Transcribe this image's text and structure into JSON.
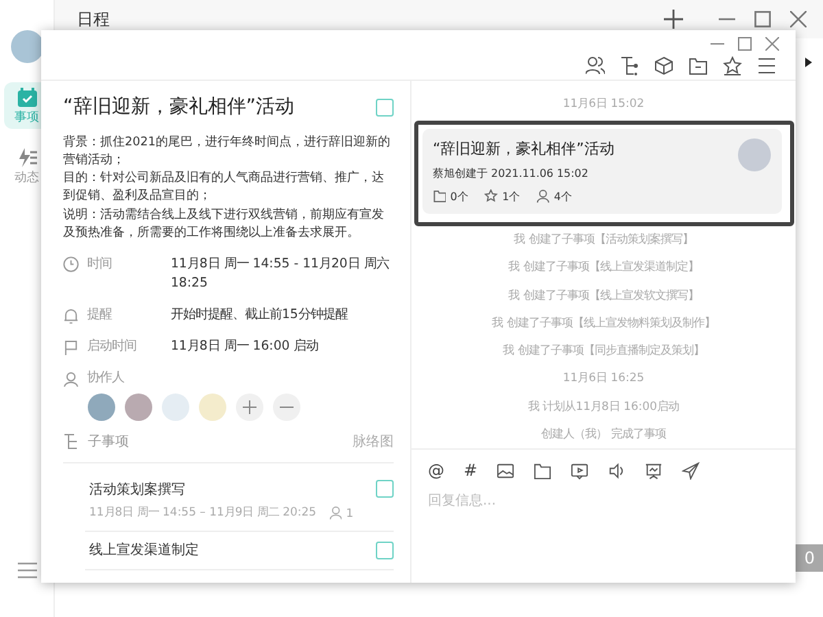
{
  "app": {
    "title": "日程",
    "nav": [
      {
        "kind": "calendar",
        "label": "事项",
        "selected": true
      },
      {
        "kind": "activity",
        "label": "动态",
        "selected": false
      }
    ],
    "badge": "0"
  },
  "task": {
    "title": "“辞旧迎新，豪礼相伴”活动",
    "checked": false,
    "description": [
      "背景：抓住2021的尾巴，进行年终时间点，进行辞旧迎新的营销活动；",
      "目的：针对公司新品及旧有的人气商品进行营销、推广，达到促销、盈利及品宣目的；",
      "说明：活动需结合线上及线下进行双线营销，前期应有宣发及预热准备，所需要的工作将围绕以上准备去求展开。"
    ],
    "fields": [
      {
        "kind": "time",
        "label": "时间",
        "value": "11月8日 周一 14:55 - 11月20日 周六 18:25"
      },
      {
        "kind": "reminder",
        "label": "提醒",
        "value": "开始时提醒、截止前15分钟提醒"
      },
      {
        "kind": "start",
        "label": "启动时间",
        "value": "11月8日 周一 16:00 启动"
      }
    ],
    "collaborators_label": "协作人",
    "subtasks_label": "子事项",
    "map_link": "脉络图",
    "subtasks": [
      {
        "title": "活动策划案撰写",
        "checked": false,
        "dates": "11月8日 周一 14:55 – 11月9日 周二 20:25",
        "members": "1"
      },
      {
        "title": "线上宣发渠道制定",
        "checked": false
      }
    ]
  },
  "activity": {
    "card": {
      "title": "“辞旧迎新，豪礼相伴”活动",
      "creator": "蔡旭创建于 2021.11.06 15:02",
      "files": "0个",
      "stars": "1个",
      "members": "4个"
    },
    "entries": [
      {
        "kind": "date",
        "text": "11月6日 15:02"
      },
      {
        "kind": "card"
      },
      {
        "kind": "log",
        "actor": "我",
        "text": "创建了子事项",
        "ref": "【活动策划案撰写】"
      },
      {
        "kind": "log",
        "actor": "我",
        "text": "创建了子事项",
        "ref": "【线上宣发渠道制定】"
      },
      {
        "kind": "log",
        "actor": "我",
        "text": "创建了子事项",
        "ref": "【线上宣发软文撰写】"
      },
      {
        "kind": "log",
        "actor": "我",
        "text": "创建了子事项",
        "ref": "【线上宣发物料策划及制作】"
      },
      {
        "kind": "log",
        "actor": "我",
        "text": "创建了子事项",
        "ref": "【同步直播制定及策划】"
      },
      {
        "kind": "date",
        "text": "11月6日 16:25"
      },
      {
        "kind": "log",
        "actor": "我",
        "text": "计划从11月8日 16:00启动"
      },
      {
        "kind": "log",
        "actor": "创建人（我）",
        "text": "完成了事项"
      }
    ],
    "composer_symbols": [
      "@",
      "#"
    ],
    "placeholder": "回复信息..."
  }
}
